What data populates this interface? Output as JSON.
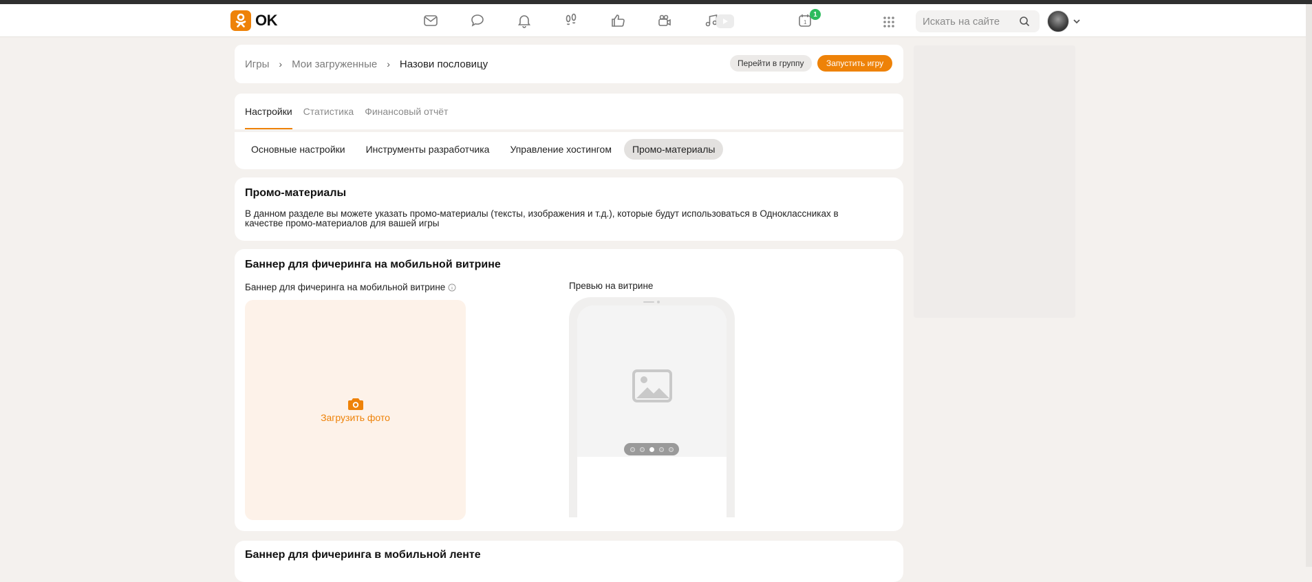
{
  "header": {
    "logo_text": "OK",
    "search_placeholder": "Искать на сайте",
    "notifications_badge": "1",
    "icons": [
      "mail-icon",
      "chat-icon",
      "bell-icon",
      "footprints-icon",
      "like-icon",
      "video-camera-icon",
      "music-icon",
      "play-icon",
      "calendar-icon",
      "apps-grid-icon",
      "search-icon",
      "chevron-down-icon"
    ]
  },
  "breadcrumbs": {
    "items": [
      "Игры",
      "Мои загруженные",
      "Назови пословицу"
    ],
    "go_to_group": "Перейти в группу",
    "launch_game": "Запустить игру"
  },
  "tabs": {
    "items": [
      "Настройки",
      "Статистика",
      "Финансовый отчёт"
    ],
    "active": "Настройки"
  },
  "subtabs": {
    "items": [
      "Основные настройки",
      "Инструменты разработчика",
      "Управление хостингом",
      "Промо-материалы"
    ],
    "active": "Промо-материалы"
  },
  "promo": {
    "title": "Промо-материалы",
    "description": "В данном разделе вы можете указать промо-материалы (тексты, изображения и т.д.), которые будут использоваться в Одноклассниках в качестве промо-материалов для вашей игры"
  },
  "banner_mobile_showcase": {
    "title": "Баннер для фичеринга на мобильной витрине",
    "field_label": "Баннер для фичеринга на мобильной витрине",
    "upload_label": "Загрузить фото",
    "preview_label": "Превью на витрине",
    "carousel_active_index": 2
  },
  "banner_mobile_feed": {
    "title": "Баннер для фичеринга в мобильной ленте"
  },
  "colors": {
    "accent": "#ee8208",
    "background": "#f4f1ee",
    "badge": "#2dbb5d"
  }
}
